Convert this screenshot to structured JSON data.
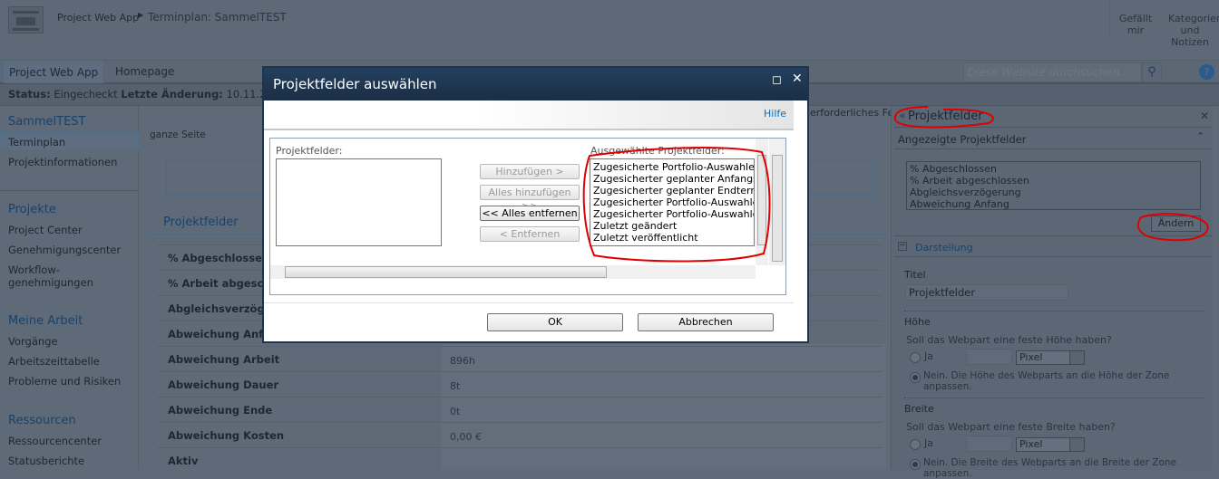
{
  "header": {
    "breadcrumb_root": "Project Web App",
    "breadcrumb_page": "Terminplan: SammelTEST",
    "like_label": "Gefällt mir",
    "tags_label": "Kategorien und Notizen"
  },
  "nav": {
    "tabs": [
      "Project Web App",
      "Homepage"
    ],
    "search_placeholder": "Diese Website durchsuchen..."
  },
  "status": {
    "status_label": "Status:",
    "status_value": "Eingecheckt",
    "changed_label": "Letzte Änderung:",
    "changed_value": "10.11.2"
  },
  "sidebar": {
    "site_title": "SammelTEST",
    "items": [
      "Terminplan",
      "Projektinformationen"
    ],
    "groups": [
      {
        "title": "Projekte",
        "items": [
          "Project Center",
          "Genehmigungscenter",
          "Workflow-genehmigungen"
        ]
      },
      {
        "title": "Meine Arbeit",
        "items": [
          "Vorgänge",
          "Arbeitszeittabelle",
          "Probleme und Risiken"
        ]
      },
      {
        "title": "Ressourcen",
        "items": [
          "Ressourcencenter",
          "Statusberichte"
        ]
      }
    ]
  },
  "main": {
    "zone_label": "ganze Seite",
    "required_hint": "erforderliches Feld",
    "webpart_title": "Projektfelder",
    "rows": [
      {
        "name": "% Abgeschlosse",
        "value": ""
      },
      {
        "name": "% Arbeit abgesc",
        "value": ""
      },
      {
        "name": "Abgleichsverzög",
        "value": ""
      },
      {
        "name": "Abweichung Anf",
        "value": ""
      },
      {
        "name": "Abweichung Arbeit",
        "value": "896h"
      },
      {
        "name": "Abweichung Dauer",
        "value": "8t"
      },
      {
        "name": "Abweichung Ende",
        "value": "0t"
      },
      {
        "name": "Abweichung Kosten",
        "value": "0,00 €"
      },
      {
        "name": "Aktiv",
        "value": ""
      }
    ]
  },
  "dialog": {
    "title": "Projektfelder auswählen",
    "help": "Hilfe",
    "available_label": "Projektfelder:",
    "selected_label": "Ausgewählte Projektfelder:",
    "add": "Hinzufügen >",
    "add_all": "Alles hinzufügen >>",
    "remove_all": "<< Alles entfernen",
    "remove": "< Entfernen",
    "selected_items": [
      "Zugesicherte Portfolio-Auswahlentsc",
      "Zugesicherter geplanter Anfangsterm",
      "Zugesicherter geplanter Endtermin",
      "Zugesicherter Portfolio-Auswahlents",
      "Zugesicherter Portfolio-Auswahlents",
      "Zuletzt geändert",
      "Zuletzt veröffentlicht"
    ],
    "ok": "OK",
    "cancel": "Abbrechen"
  },
  "toolpane": {
    "title": "Projektfelder",
    "section1": "Angezeigte Projektfelder",
    "fields": [
      "% Abgeschlossen",
      "% Arbeit abgeschlossen",
      "Abgleichsverzögerung",
      "Abweichung Anfang"
    ],
    "change": "Ändern",
    "section2": "Darstellung",
    "title_label": "Titel",
    "title_value": "Projektfelder",
    "height_label": "Höhe",
    "height_q": "Soll das Webpart eine feste Höhe haben?",
    "yes": "Ja",
    "unit": "Pixel",
    "height_no": "Nein. Die Höhe des Webparts an die Höhe der Zone anpassen.",
    "width_label": "Breite",
    "width_q": "Soll das Webpart eine feste Breite haben?",
    "width_no": "Nein. Die Breite des Webparts an die Breite der Zone anpassen."
  },
  "colors": {
    "annotation": "#e00000",
    "dialog_header": "#1f3652",
    "link": "#0072c6"
  }
}
